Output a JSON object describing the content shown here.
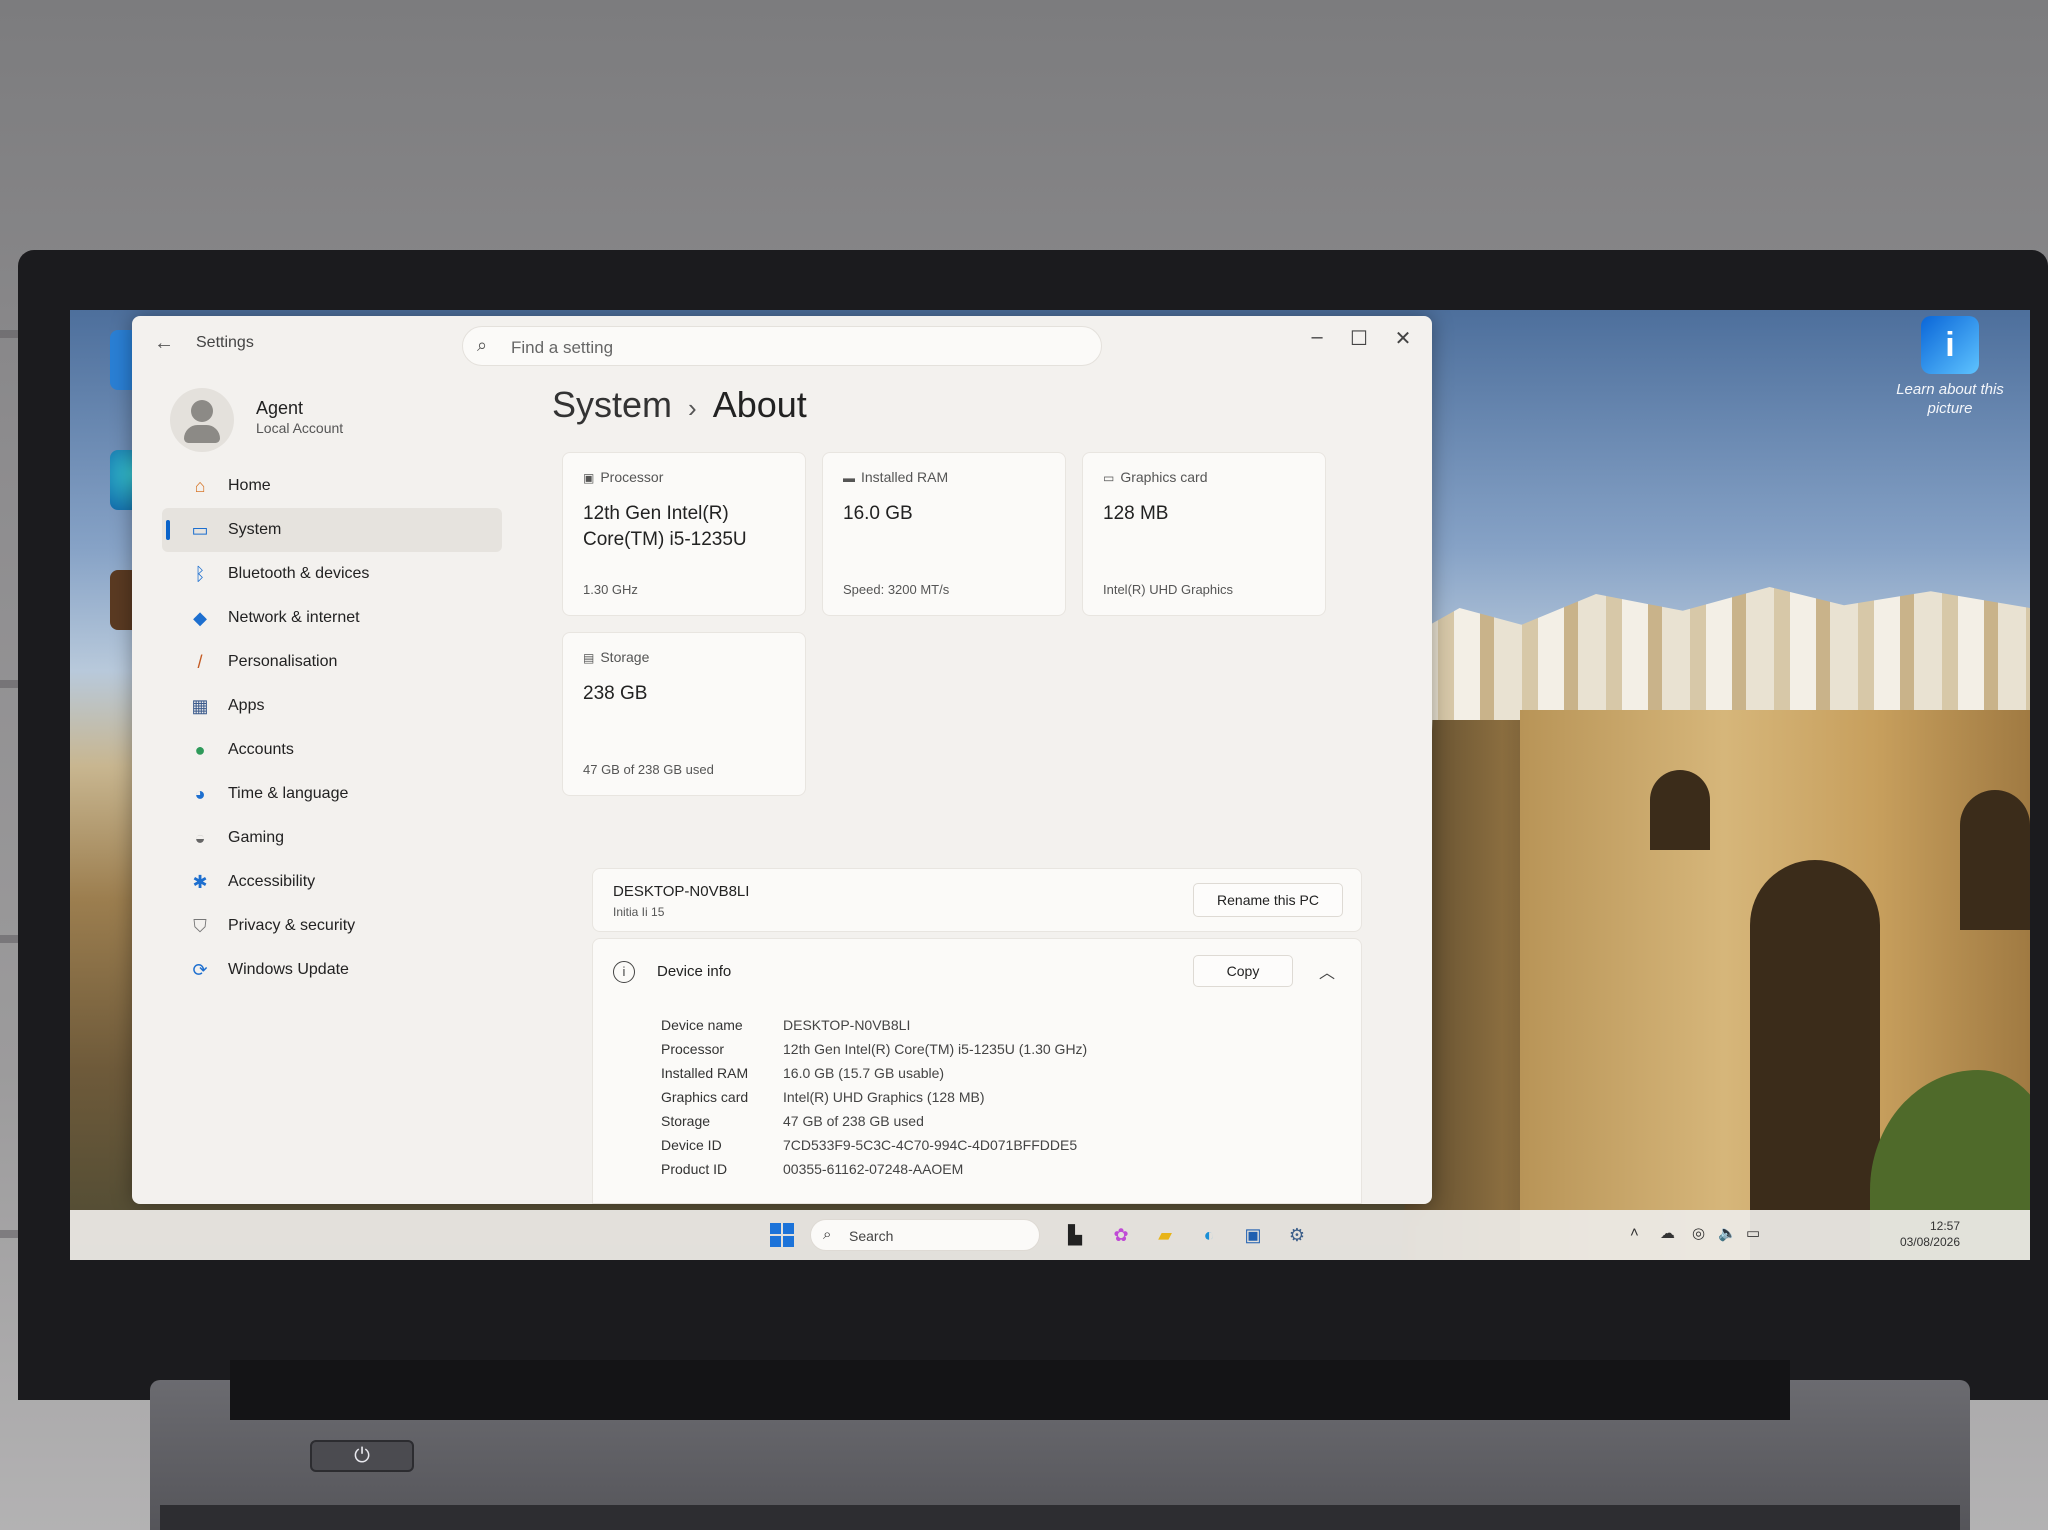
{
  "desktop": {
    "learn_picture": "Learn about this picture"
  },
  "settings": {
    "app_title": "Settings",
    "search_placeholder": "Find a setting",
    "user": {
      "name": "Agent",
      "account_type": "Local Account"
    },
    "nav": [
      {
        "label": "Home",
        "icon": "home-icon"
      },
      {
        "label": "System",
        "icon": "system-icon",
        "active": true
      },
      {
        "label": "Bluetooth & devices",
        "icon": "bluetooth-icon"
      },
      {
        "label": "Network & internet",
        "icon": "wifi-icon"
      },
      {
        "label": "Personalisation",
        "icon": "brush-icon"
      },
      {
        "label": "Apps",
        "icon": "apps-icon"
      },
      {
        "label": "Accounts",
        "icon": "person-icon"
      },
      {
        "label": "Time & language",
        "icon": "globe-icon"
      },
      {
        "label": "Gaming",
        "icon": "gamepad-icon"
      },
      {
        "label": "Accessibility",
        "icon": "accessibility-icon"
      },
      {
        "label": "Privacy & security",
        "icon": "shield-icon"
      },
      {
        "label": "Windows Update",
        "icon": "update-icon"
      }
    ],
    "breadcrumb": {
      "parent": "System",
      "current": "About"
    },
    "cards": {
      "processor": {
        "label": "Processor",
        "value": "12th Gen Intel(R) Core(TM) i5-1235U",
        "detail": "1.30 GHz"
      },
      "ram": {
        "label": "Installed RAM",
        "value": "16.0 GB",
        "detail": "Speed: 3200 MT/s"
      },
      "graphics": {
        "label": "Graphics card",
        "value": "128 MB",
        "detail": "Intel(R) UHD Graphics"
      },
      "storage": {
        "label": "Storage",
        "value": "238 GB",
        "detail": "47 GB of 238 GB used"
      }
    },
    "pc": {
      "name": "DESKTOP-N0VB8LI",
      "model": "Initia Ii 15",
      "rename_label": "Rename this PC"
    },
    "device_info": {
      "title": "Device info",
      "copy_label": "Copy",
      "specs": [
        {
          "key": "Device name",
          "value": "DESKTOP-N0VB8LI"
        },
        {
          "key": "Processor",
          "value": "12th Gen Intel(R) Core(TM) i5-1235U (1.30 GHz)"
        },
        {
          "key": "Installed RAM",
          "value": "16.0 GB (15.7 GB usable)"
        },
        {
          "key": "Graphics card",
          "value": "Intel(R) UHD Graphics (128 MB)"
        },
        {
          "key": "Storage",
          "value": "47 GB of 238 GB used"
        },
        {
          "key": "Device ID",
          "value": "7CD533F9-5C3C-4C70-994C-4D071BFFDDE5"
        },
        {
          "key": "Product ID",
          "value": "00355-61162-07248-AAOEM"
        }
      ]
    }
  },
  "taskbar": {
    "search_label": "Search",
    "time": "12:57",
    "date": "03/08/2026"
  }
}
